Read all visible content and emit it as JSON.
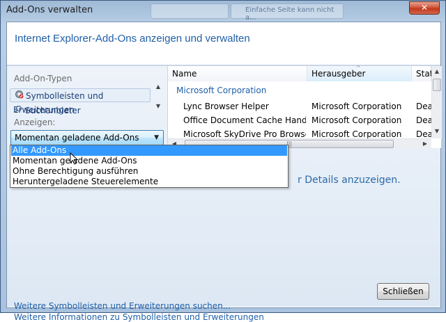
{
  "window": {
    "title": "Add-Ons verwalten",
    "close_glyph": "✕",
    "background_tabs": [
      "Einfache Seite kann nicht a..."
    ]
  },
  "header": {
    "title": "Internet Explorer-Add-Ons anzeigen und verwalten"
  },
  "left": {
    "types_heading": "Add-On-Typen",
    "types": [
      {
        "label": "Symbolleisten und Erweiterungen",
        "icon": "gear-block-icon",
        "selected": true
      },
      {
        "label": "Suchanbieter",
        "icon": "search-icon",
        "selected": false
      }
    ],
    "show_label": "Anzeigen:",
    "show_value": "Momentan geladene Add-Ons"
  },
  "list": {
    "columns": [
      "Name",
      "Herausgeber",
      "Stat"
    ],
    "sorted_column": "Herausgeber",
    "group": "Microsoft Corporation",
    "rows": [
      {
        "name": "Lync Browser Helper",
        "publisher": "Microsoft Corporation",
        "status": "Dea"
      },
      {
        "name": "Office Document Cache Handler",
        "publisher": "Microsoft Corporation",
        "status": "Dea"
      },
      {
        "name": "Microsoft SkyDrive Pro Browser ...",
        "publisher": "Microsoft Corporation",
        "status": "Dea"
      }
    ]
  },
  "detail_hint": "r Details anzuzeigen.",
  "dropdown_options": {
    "items": [
      "Alle Add-Ons",
      "Momentan geladene Add-Ons",
      "Ohne Berechtigung ausführen",
      "Heruntergeladene Steuerelemente"
    ],
    "highlighted": "Alle Add-Ons"
  },
  "footer": {
    "link1": "Weitere Symbolleisten und Erweiterungen suchen...",
    "link2": "Weitere Informationen zu Symbolleisten und Erweiterungen",
    "close_button": "Schließen"
  },
  "colors": {
    "accent": "#1f5fa8",
    "highlight": "#3399ff"
  }
}
